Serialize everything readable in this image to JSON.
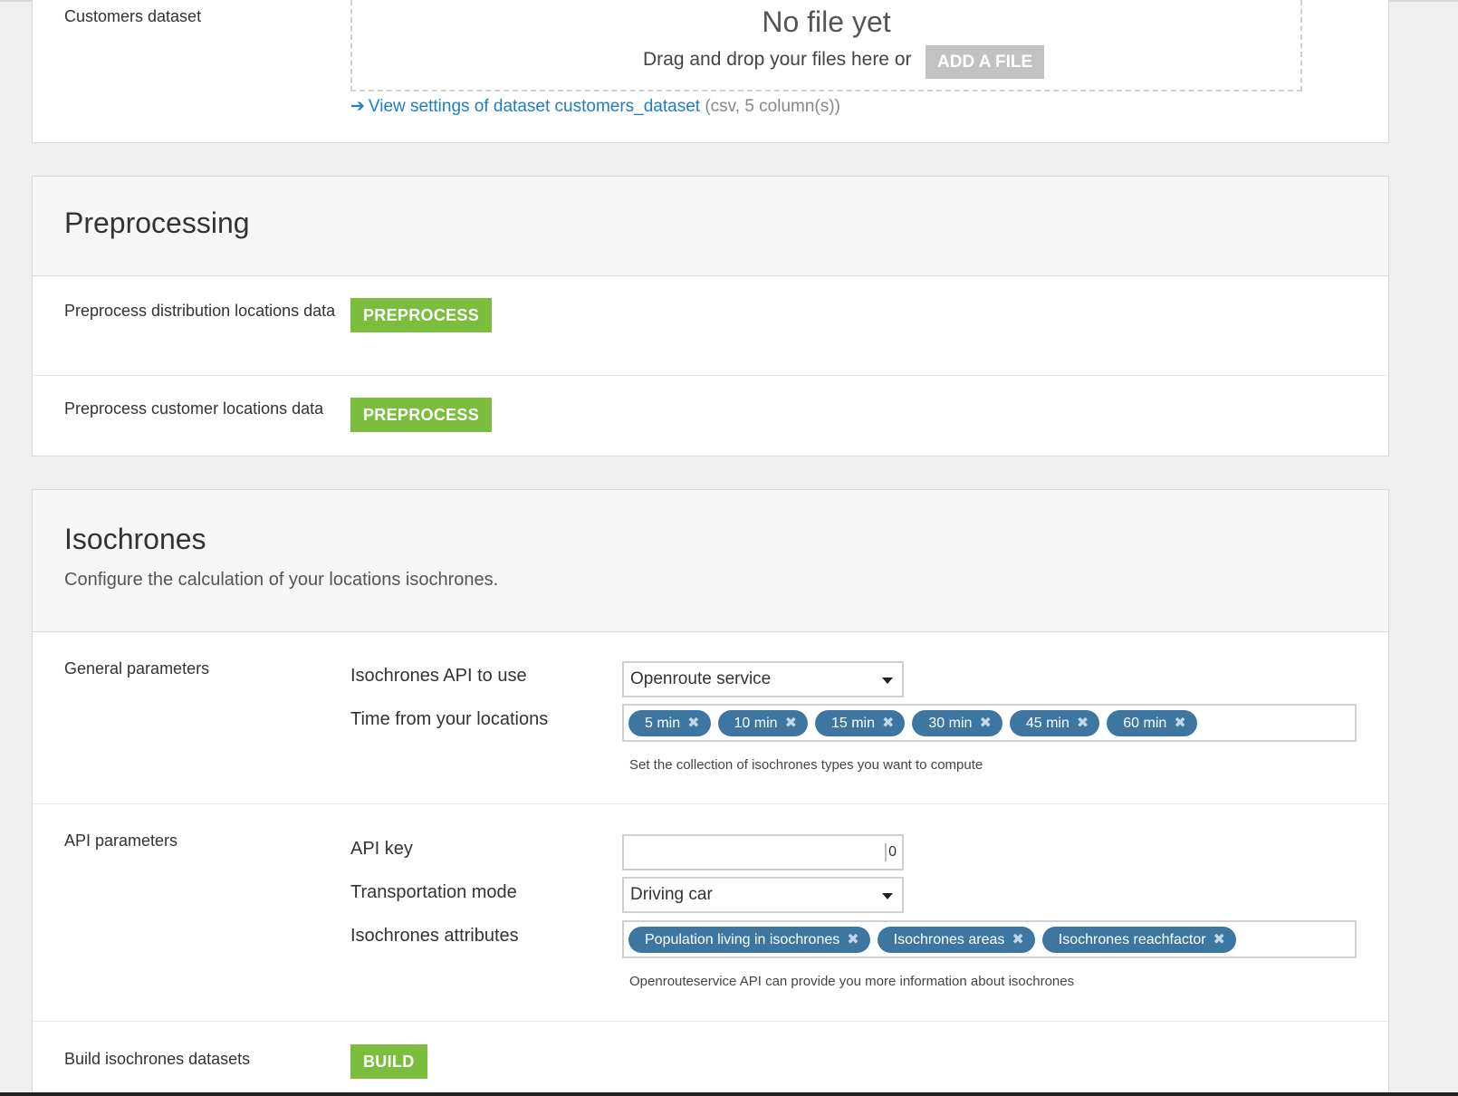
{
  "customers_card": {
    "label": "Customers dataset",
    "dropzone_title": "No file yet",
    "dropzone_text": "Drag and drop your files here or",
    "add_file_label": "ADD A FILE",
    "view_link_text": "View settings of dataset customers_dataset",
    "view_link_meta": "(csv, 5 column(s))"
  },
  "preprocessing": {
    "title": "Preprocessing",
    "rows": [
      {
        "label": "Preprocess distribution locations data",
        "button": "PREPROCESS"
      },
      {
        "label": "Preprocess customer locations data",
        "button": "PREPROCESS"
      }
    ]
  },
  "isochrones": {
    "title": "Isochrones",
    "description": "Configure the calculation of your locations isochrones.",
    "general": {
      "label": "General parameters",
      "api_label": "Isochrones API to use",
      "api_value": "Openroute service",
      "time_label": "Time from your locations",
      "time_tags": [
        "5 min",
        "10 min",
        "15 min",
        "30 min",
        "45 min",
        "60 min"
      ],
      "time_help": "Set the collection of isochrones types you want to compute"
    },
    "api": {
      "label": "API parameters",
      "key_label": "API key",
      "key_glyph": "0",
      "mode_label": "Transportation mode",
      "mode_value": "Driving car",
      "attrs_label": "Isochrones attributes",
      "attr_tags": [
        "Population living in isochrones",
        "Isochrones areas",
        "Isochrones reachfactor"
      ],
      "attrs_help": "Openrouteservice API can provide you more information about isochrones"
    },
    "build": {
      "label": "Build isochrones datasets",
      "button": "BUILD"
    }
  },
  "icons": {
    "link_arrow": "arrow-right-icon",
    "tag_remove": "close-icon",
    "select_caret": "chevron-down-icon"
  },
  "colors": {
    "primary_green": "#7bbd3d",
    "tag_blue": "#3d76a1",
    "link_blue": "#1f7dc6",
    "disabled_gray": "#c2c2c2"
  }
}
